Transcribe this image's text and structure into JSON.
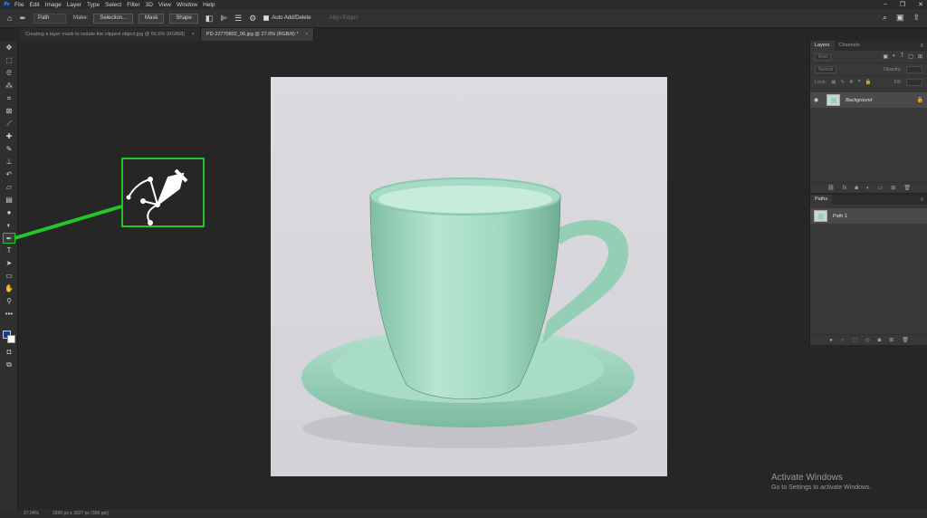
{
  "menu": {
    "items": [
      "File",
      "Edit",
      "Image",
      "Layer",
      "Type",
      "Select",
      "Filter",
      "3D",
      "View",
      "Window",
      "Help"
    ]
  },
  "options_bar": {
    "mode_value": "Path",
    "make_label": "Make:",
    "selection_button": "Selection...",
    "mask_button": "Mask",
    "shape_button": "Shape",
    "auto_add_delete_label": "Auto Add/Delete",
    "align_edges_label": "Align Edges"
  },
  "tabs": [
    {
      "label": "Creating a layer mask to isolate the clipped object.jpg @ 66.6% (RGB/8)",
      "active": false
    },
    {
      "label": "PD-22770802_06.jpg @ 27.0% (RGB/8) *",
      "active": true
    }
  ],
  "layers_panel": {
    "tabs": [
      "Layers",
      "Channels"
    ],
    "kind_placeholder": "Kind",
    "blend_mode": "Normal",
    "opacity_label": "Opacity:",
    "lock_label": "Lock:",
    "fill_label": "Fill:",
    "layer_name": "Background"
  },
  "paths_panel": {
    "title": "Paths",
    "path_name": "Path 1"
  },
  "activation": {
    "title": "Activate Windows",
    "subtitle": "Go to Settings to activate Windows."
  },
  "status": {
    "zoom": "27.04%",
    "info": "2990 px x 3027 px (300 ppi)"
  },
  "colors": {
    "accent_green": "#22c52a",
    "foreground_color": "#1a3d8f",
    "cup_green": "#a3dcc3"
  }
}
